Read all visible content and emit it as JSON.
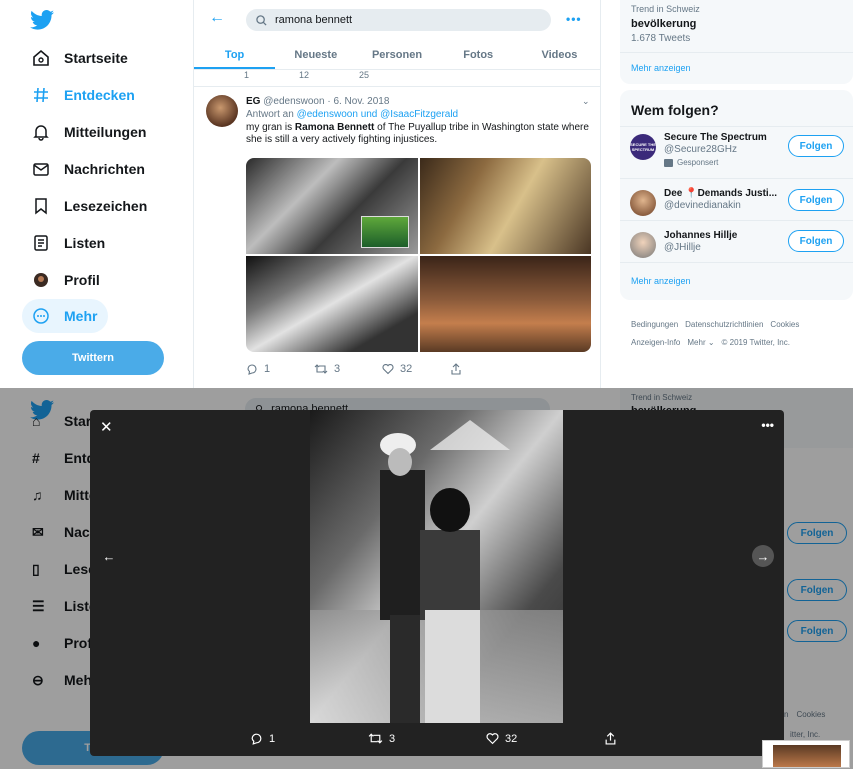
{
  "nav": {
    "items": [
      {
        "label": "Startseite",
        "icon": "home-icon"
      },
      {
        "label": "Entdecken",
        "icon": "hashtag-icon"
      },
      {
        "label": "Mitteilungen",
        "icon": "bell-icon"
      },
      {
        "label": "Nachrichten",
        "icon": "mail-icon"
      },
      {
        "label": "Lesezeichen",
        "icon": "bookmark-icon"
      },
      {
        "label": "Listen",
        "icon": "list-icon"
      },
      {
        "label": "Profil",
        "icon": "avatar-icon"
      },
      {
        "label": "Mehr",
        "icon": "more-icon"
      }
    ],
    "tweet_button": "Twittern",
    "truncated": [
      "Start",
      "Entd",
      "Mitte",
      "Nach",
      "Lese",
      "Liste",
      "Profi",
      "Mehr"
    ],
    "truncated_button": "Twi"
  },
  "search": {
    "query": "ramona bennett"
  },
  "search_overlay": {
    "query": "ramona bennett"
  },
  "tabs": [
    "Top",
    "Neueste",
    "Personen",
    "Fotos",
    "Videos"
  ],
  "prev_actions": {
    "replies": "1",
    "retweets": "12",
    "likes": "25"
  },
  "tweet": {
    "name": "EG",
    "handle": "@edenswoon",
    "date": "6. Nov. 2018",
    "reply_prefix": "Antwort an",
    "reply_to_1": "@edenswoon",
    "reply_and": "und",
    "reply_to_2": "@IsaacFitzgerald",
    "text_before": "my gran is ",
    "text_bold": "Ramona Bennett",
    "text_after": " of The Puyallup tribe in Washington state where she is still a very actively fighting injustices.",
    "replies": "1",
    "retweets": "3",
    "likes": "32"
  },
  "trend": {
    "label": "Trend in Schweiz",
    "title": "bevölkerung",
    "count": "1.678 Tweets",
    "more": "Mehr anzeigen"
  },
  "trend_overlay": {
    "label": "Trend in Schweiz",
    "title": "bevölkerung"
  },
  "who_to_follow": {
    "title": "Wem folgen?",
    "follow_label": "Folgen",
    "suggestions": [
      {
        "name": "Secure The Spectrum",
        "handle": "@Secure28GHz",
        "promo": "Gesponsert",
        "avatar_text": "SECURE THE SPECTRUM"
      },
      {
        "name": "Dee 📍Demands Justi...",
        "handle": "@devinedianakin"
      },
      {
        "name": "Johannes Hillje",
        "handle": "@JHillje"
      }
    ],
    "more": "Mehr anzeigen"
  },
  "footer": {
    "line1": [
      "Bedingungen",
      "Datenschutzrichtlinien",
      "Cookies"
    ],
    "line2": [
      "Anzeigen-Info",
      "Mehr ⌄",
      "© 2019 Twitter, Inc."
    ],
    "overlay_fragments": [
      "n",
      "Cookies",
      "itter, Inc."
    ]
  },
  "modal": {
    "replies": "1",
    "retweets": "3",
    "likes": "32"
  }
}
